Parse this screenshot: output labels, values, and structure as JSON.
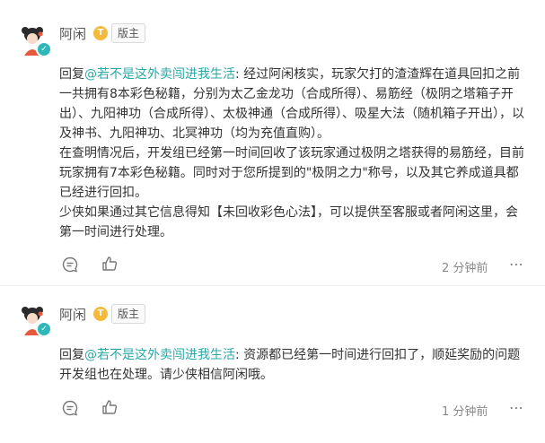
{
  "posts": [
    {
      "username": "阿闲",
      "level_badge": "T",
      "role_badge": "版主",
      "reply_prefix": "回复",
      "mention": "@若不是这外卖闯进我生活",
      "paragraphs": [
        ": 经过阿闲核实，玩家欠打的渣渣辉在道具回扣之前一共拥有8本彩色秘籍，分别为太乙金龙功（合成所得）、易筋经（极阴之塔箱子开出）、九阳神功（合成所得）、太极神通（合成所得）、吸星大法（随机箱子开出），以及神书、九阳神功、北冥神功（均为充值直购）。",
        "在查明情况后，开发组已经第一时间回收了该玩家通过极阴之塔获得的易筋经，目前玩家拥有7本彩色秘籍。同时对于您所提到的\"极阴之力\"称号，以及其它养成道具都已经进行回扣。",
        "少侠如果通过其它信息得知【未回收彩色心法】，可以提供至客服或者阿闲这里，会第一时间进行处理。"
      ],
      "time": "2 分钟前"
    },
    {
      "username": "阿闲",
      "level_badge": "T",
      "role_badge": "版主",
      "reply_prefix": "回复",
      "mention": "@若不是这外卖闯进我生活",
      "paragraphs": [
        ": 资源都已经第一时间进行回扣了，顺延奖励的问题开发组也在处理。请少侠相信阿闲哦。"
      ],
      "time": "1 分钟前"
    }
  ],
  "colors": {
    "mention": "#2aa8a8",
    "level_badge": "#f5b93b",
    "verify": "#2fb7b7"
  },
  "icons": [
    "comment-icon",
    "like-icon",
    "more-icon"
  ]
}
